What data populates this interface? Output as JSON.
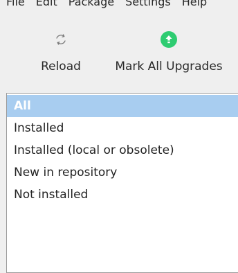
{
  "menubar": {
    "items": [
      "File",
      "Edit",
      "Package",
      "Settings",
      "Help"
    ]
  },
  "toolbar": {
    "reload_label": "Reload",
    "mark_all_upgrades_label": "Mark All Upgrades",
    "accent_color": "#2ecc71"
  },
  "filters": {
    "items": [
      "All",
      "Installed",
      "Installed (local or obsolete)",
      "New in repository",
      "Not installed"
    ],
    "selected_index": 0,
    "selected_color": "#a8cdf0"
  },
  "icons": {
    "reload": "reload-icon",
    "mark_all_upgrades": "upgrade-arrow-icon"
  }
}
